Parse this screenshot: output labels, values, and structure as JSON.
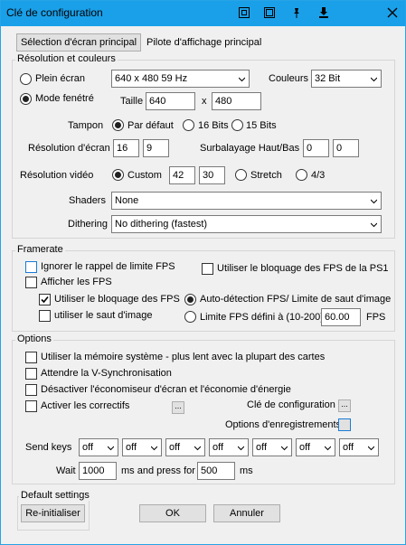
{
  "window": {
    "title": "Clé de configuration"
  },
  "top": {
    "select_screen_button": "Sélection d'écran principal",
    "driver_label": "Pilote d'affichage principal"
  },
  "resolution_group": {
    "title": "Résolution et couleurs",
    "fullscreen_label": "Plein écran",
    "fullscreen_mode_value": "640 x 480  59 Hz",
    "colors_label": "Couleurs",
    "colors_value": "32 Bit",
    "windowed_label": "Mode fenétré",
    "size_label": "Taille",
    "width_value": "640",
    "x_label": "x",
    "height_value": "480",
    "buffer_label": "Tampon",
    "buffer_default": "Par défaut",
    "buffer_16": "16 Bits",
    "buffer_15": "15 Bits",
    "screen_res_label": "Résolution d'écran",
    "screen_res_a": "16",
    "screen_res_b": "9",
    "overscan_label": "Surbalayage Haut/Bas",
    "overscan_a": "0",
    "overscan_b": "0",
    "video_res_label": "Résolution vidéo",
    "video_custom": "Custom",
    "video_w": "42",
    "video_h": "30",
    "video_stretch": "Stretch",
    "video_43": "4/3",
    "shaders_label": "Shaders",
    "shaders_value": "None",
    "dithering_label": "Dithering",
    "dithering_value": "No dithering (fastest)"
  },
  "framerate_group": {
    "title": "Framerate",
    "ignore_fps": "Ignorer le rappel de limite FPS",
    "use_ps1_fps": "Utiliser le bloquage des FPS de la PS1",
    "show_fps": "Afficher les FPS",
    "use_fps_lock": "Utiliser le bloquage des FPS",
    "auto_detect": "Auto-détection FPS/ Limite de saut d'image",
    "frame_skip": "utiliser le saut d'image",
    "fps_limit": "Limite FPS défini à (10-200)",
    "fps_value": "60.00",
    "fps_unit": "FPS"
  },
  "options_group": {
    "title": "Options",
    "sys_mem": "Utiliser la mémoire système - plus lent avec la plupart des cartes",
    "vsync": "Attendre la V-Synchronisation",
    "screensaver": "Désactiver l'économiseur d'écran et l'économie d'énergie",
    "patches": "Activer les correctifs",
    "dots": "...",
    "config_key": "Clé de configuration",
    "save_options": "Options d'enregistrements",
    "send_keys_label": "Send keys",
    "send_keys": [
      "off",
      "off",
      "off",
      "off",
      "off",
      "off",
      "off"
    ],
    "wait_label": "Wait",
    "wait_value": "1000",
    "press_for_label": "ms and press for",
    "press_value": "500",
    "ms_label": "ms"
  },
  "default_group": {
    "title": "Default settings",
    "reset_button": "Re-initialiser"
  },
  "buttons": {
    "ok": "OK",
    "cancel": "Annuler"
  }
}
